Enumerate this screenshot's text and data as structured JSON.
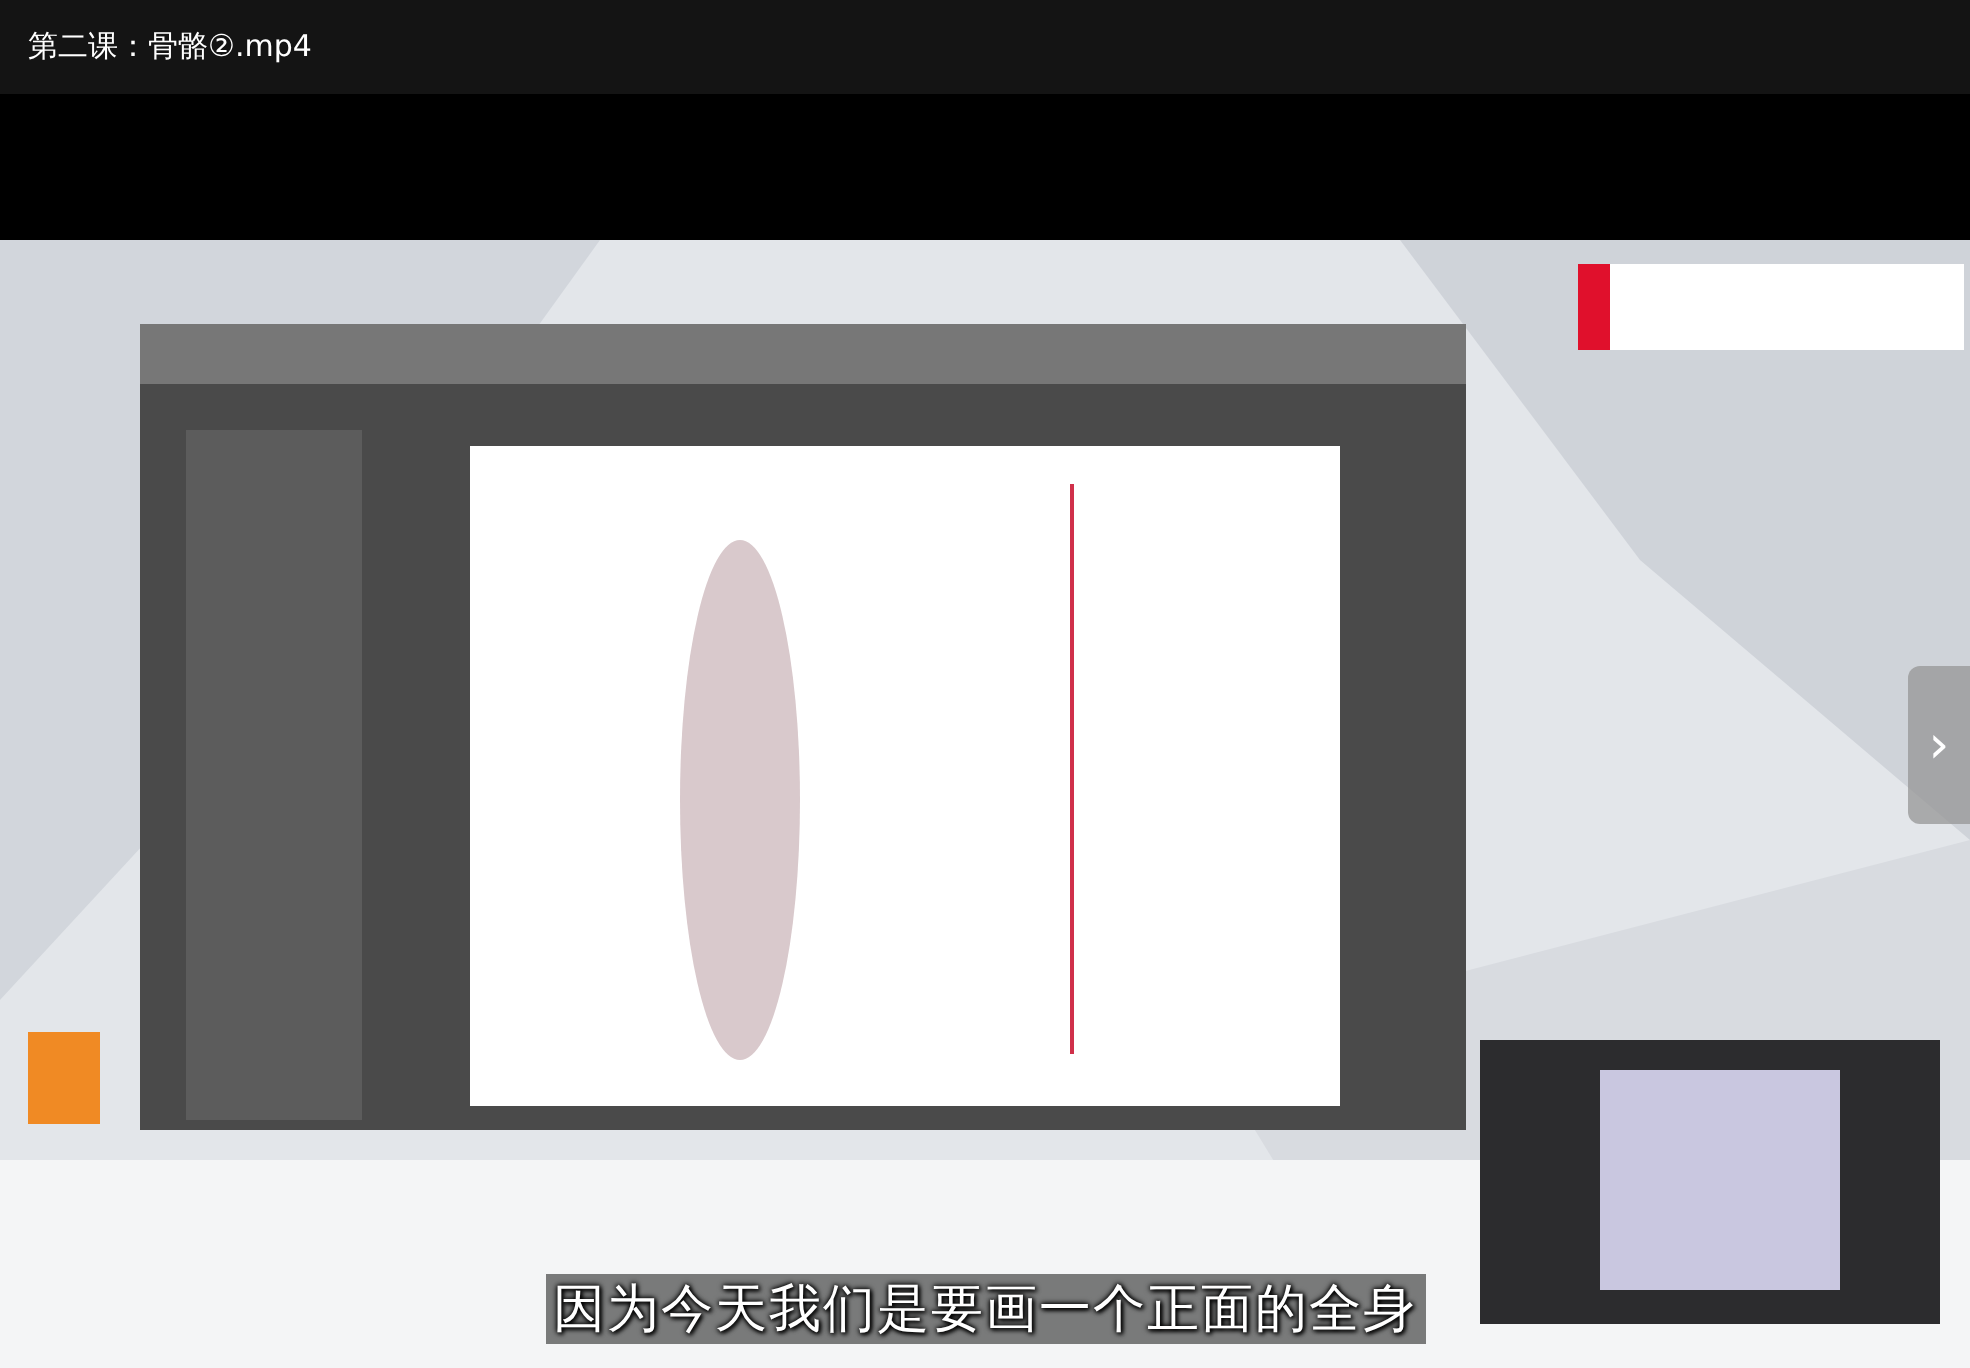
{
  "title_bar": {
    "title": "第二课：骨骼②.mp4"
  },
  "video": {
    "kind": "picture",
    "subtitle": "因为今天我们是要画一个正面的全身",
    "next_button": {
      "label": "›"
    }
  }
}
